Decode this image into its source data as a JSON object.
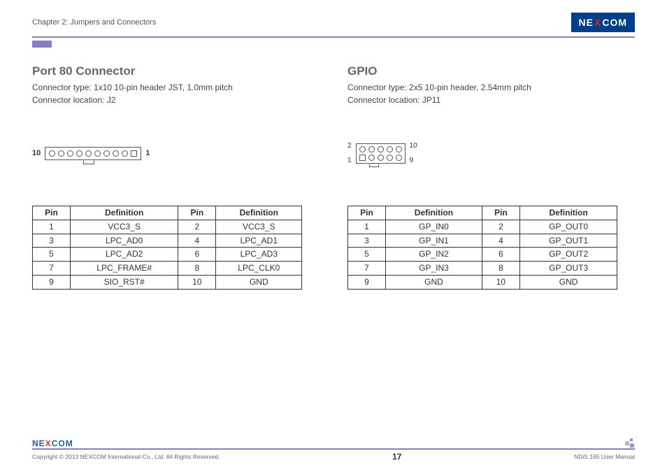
{
  "header": {
    "chapter": "Chapter 2: Jumpers and Connectors",
    "logo_parts": {
      "pre": "NE",
      "x": "X",
      "post": "COM"
    }
  },
  "left": {
    "title": "Port 80 Connector",
    "conn_type": "Connector type: 1x10 10-pin header JST, 1.0mm pitch",
    "conn_loc": "Connector location: J2",
    "diagram": {
      "left_label": "10",
      "right_label": "1"
    },
    "table": {
      "headers": [
        "Pin",
        "Definition",
        "Pin",
        "Definition"
      ],
      "rows": [
        [
          "1",
          "VCC3_S",
          "2",
          "VCC3_S"
        ],
        [
          "3",
          "LPC_AD0",
          "4",
          "LPC_AD1"
        ],
        [
          "5",
          "LPC_AD2",
          "6",
          "LPC_AD3"
        ],
        [
          "7",
          "LPC_FRAME#",
          "8",
          "LPC_CLK0"
        ],
        [
          "9",
          "SIO_RST#",
          "10",
          "GND"
        ]
      ]
    }
  },
  "right": {
    "title": "GPIO",
    "conn_type": "Connector type: 2x5 10-pin header, 2.54mm pitch",
    "conn_loc": "Connector location: JP11",
    "diagram": {
      "top_left": "2",
      "top_right": "10",
      "bot_left": "1",
      "bot_right": "9"
    },
    "table": {
      "headers": [
        "Pin",
        "Definition",
        "Pin",
        "Definition"
      ],
      "rows": [
        [
          "1",
          "GP_IN0",
          "2",
          "GP_OUT0"
        ],
        [
          "3",
          "GP_IN1",
          "4",
          "GP_OUT1"
        ],
        [
          "5",
          "GP_IN2",
          "6",
          "GP_OUT2"
        ],
        [
          "7",
          "GP_IN3",
          "8",
          "GP_OUT3"
        ],
        [
          "9",
          "GND",
          "10",
          "GND"
        ]
      ]
    }
  },
  "footer": {
    "copyright": "Copyright © 2013 NEXCOM International Co., Ltd. All Rights Reserved.",
    "page": "17",
    "manual": "NDiS 165 User Manual"
  }
}
